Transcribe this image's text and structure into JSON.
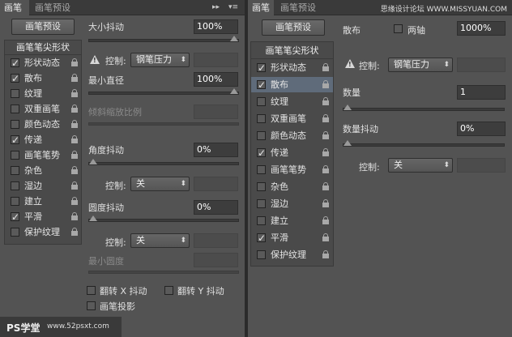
{
  "left_panel": {
    "tabs": [
      "画笔",
      "画笔预设"
    ],
    "preset_button": "画笔预设",
    "list_title": "画笔笔尖形状",
    "items": [
      {
        "label": "形状动态",
        "checked": true,
        "lock": true
      },
      {
        "label": "散布",
        "checked": true,
        "lock": true
      },
      {
        "label": "纹理",
        "checked": false,
        "lock": true
      },
      {
        "label": "双重画笔",
        "checked": false,
        "lock": true
      },
      {
        "label": "颜色动态",
        "checked": false,
        "lock": true
      },
      {
        "label": "传递",
        "checked": true,
        "lock": true
      },
      {
        "label": "画笔笔势",
        "checked": false,
        "lock": true
      },
      {
        "label": "杂色",
        "checked": false,
        "lock": true
      },
      {
        "label": "湿边",
        "checked": false,
        "lock": true
      },
      {
        "label": "建立",
        "checked": false,
        "lock": true
      },
      {
        "label": "平滑",
        "checked": true,
        "lock": true
      },
      {
        "label": "保护纹理",
        "checked": false,
        "lock": true
      }
    ],
    "size_jitter_label": "大小抖动",
    "size_jitter_value": "100%",
    "control_label": "控制:",
    "control_value": "钢笔压力",
    "min_diameter_label": "最小直径",
    "min_diameter_value": "100%",
    "tilt_scale_label": "倾斜缩放比例",
    "angle_jitter_label": "角度抖动",
    "angle_jitter_value": "0%",
    "angle_control_label": "控制:",
    "angle_control_value": "关",
    "roundness_jitter_label": "圆度抖动",
    "roundness_jitter_value": "0%",
    "roundness_control_label": "控制:",
    "roundness_control_value": "关",
    "min_roundness_label": "最小圆度",
    "flip_x_label": "翻转 X 抖动",
    "flip_y_label": "翻转 Y 抖动",
    "brush_projection_label": "画笔投影",
    "size_jitter_level": 1.0,
    "min_diameter_level": 1.0,
    "angle_jitter_level": 0,
    "roundness_jitter_level": 0
  },
  "right_panel": {
    "tabs": [
      "画笔",
      "画笔预设"
    ],
    "site_text": "思缘设计论坛 WWW.MISSYUAN.COM",
    "preset_button": "画笔预设",
    "list_title": "画笔笔尖形状",
    "items": [
      {
        "label": "形状动态",
        "checked": true,
        "lock": true,
        "selected": false
      },
      {
        "label": "散布",
        "checked": true,
        "lock": true,
        "selected": true
      },
      {
        "label": "纹理",
        "checked": false,
        "lock": true,
        "selected": false
      },
      {
        "label": "双重画笔",
        "checked": false,
        "lock": true,
        "selected": false
      },
      {
        "label": "颜色动态",
        "checked": false,
        "lock": true,
        "selected": false
      },
      {
        "label": "传递",
        "checked": true,
        "lock": true,
        "selected": false
      },
      {
        "label": "画笔笔势",
        "checked": false,
        "lock": true,
        "selected": false
      },
      {
        "label": "杂色",
        "checked": false,
        "lock": true,
        "selected": false
      },
      {
        "label": "湿边",
        "checked": false,
        "lock": true,
        "selected": false
      },
      {
        "label": "建立",
        "checked": false,
        "lock": true,
        "selected": false
      },
      {
        "label": "平滑",
        "checked": true,
        "lock": true,
        "selected": false
      },
      {
        "label": "保护纹理",
        "checked": false,
        "lock": true,
        "selected": false
      }
    ],
    "scatter_label": "散布",
    "both_axes_label": "两轴",
    "scatter_value": "1000%",
    "control_label": "控制:",
    "control_value": "钢笔压力",
    "count_label": "数量",
    "count_value": "1",
    "count_jitter_label": "数量抖动",
    "count_jitter_value": "0%",
    "count_control_label": "控制:",
    "count_control_value": "关",
    "count_level": 0,
    "count_jitter_level": 0
  },
  "watermark": {
    "logo": "PS学堂",
    "url": "www.52psxt.com"
  }
}
